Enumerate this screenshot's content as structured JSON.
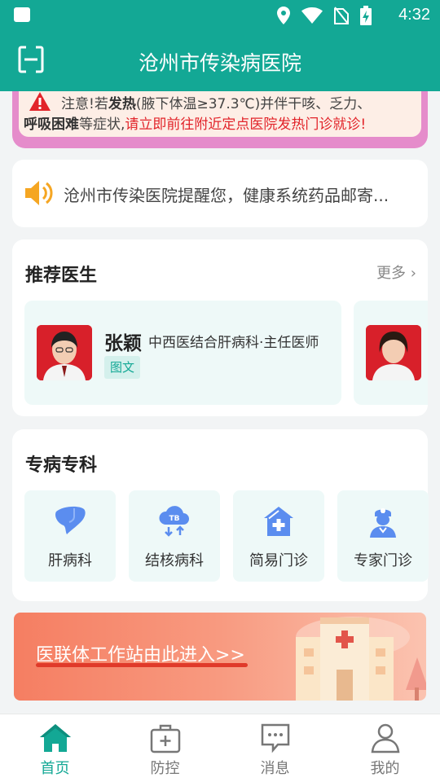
{
  "status_bar": {
    "time": "4:32"
  },
  "app_bar": {
    "title": "沧州市传染病医院"
  },
  "notice": {
    "prefix": "注意!",
    "part1": "若",
    "fever": "发热",
    "part2": "(腋下体温≥37.3℃)并伴干咳、乏力、",
    "breath": "呼吸困难",
    "part3": "等症状,",
    "urgent": "请立即前往附近定点医院发热门诊就诊!"
  },
  "announcement": {
    "text": "沧州市传染医院提醒您，健康系统药品邮寄..."
  },
  "doctors": {
    "title": "推荐医生",
    "more": "更多",
    "items": [
      {
        "name": "张颖",
        "title": "中西医结合肝病科·主任医师",
        "tag": "图文"
      }
    ]
  },
  "specialty": {
    "title": "专病专科",
    "items": [
      {
        "label": "肝病科",
        "icon": "liver-icon"
      },
      {
        "label": "结核病科",
        "icon": "tb-cloud-icon"
      },
      {
        "label": "简易门诊",
        "icon": "clinic-house-icon"
      },
      {
        "label": "专家门诊",
        "icon": "nurse-icon"
      }
    ]
  },
  "banner": {
    "text": "医联体工作站由此进入>>"
  },
  "tabs": [
    {
      "label": "首页",
      "icon": "home-icon",
      "active": true
    },
    {
      "label": "防控",
      "icon": "medkit-icon"
    },
    {
      "label": "消息",
      "icon": "message-icon"
    },
    {
      "label": "我的",
      "icon": "user-icon"
    }
  ],
  "colors": {
    "primary": "#13a895",
    "warning_red": "#e2242a",
    "banner_start": "#f57e62"
  }
}
